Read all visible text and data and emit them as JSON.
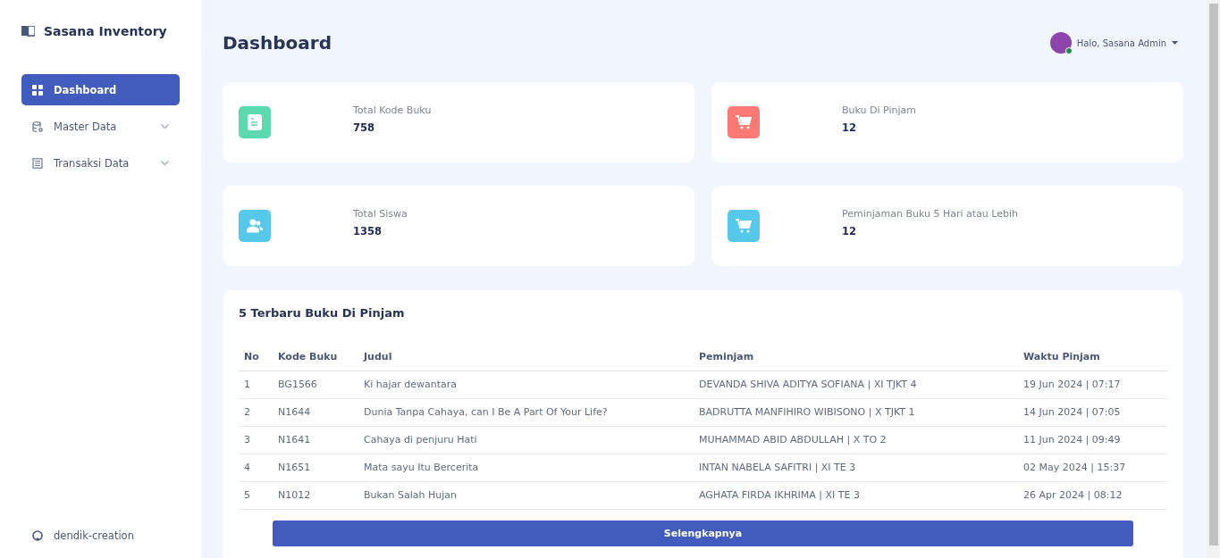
{
  "sidebar": {
    "brand": "Sasana Inventory",
    "items": [
      {
        "label": "Dashboard",
        "selected": true,
        "expandable": false
      },
      {
        "label": "Master Data",
        "selected": false,
        "expandable": true
      },
      {
        "label": "Transaksi Data",
        "selected": false,
        "expandable": true
      }
    ],
    "footer_link": "dendik-creation"
  },
  "header": {
    "title": "Dashboard",
    "user": "Halo, Sasana Admin",
    "online": true
  },
  "stats": [
    {
      "label": "Total Kode Buku",
      "value": "758",
      "color": "#5dd9b0"
    },
    {
      "label": "Buku Di Pinjam",
      "value": "12",
      "color": "#fc7a73"
    },
    {
      "label": "Total Siswa",
      "value": "1358",
      "color": "#56c9ea"
    },
    {
      "label": "Peminjaman Buku 5 Hari atau Lebih",
      "value": "12",
      "color": "#56c9ea"
    }
  ],
  "table": {
    "title": "5 Terbaru Buku Di Pinjam",
    "columns": [
      "No",
      "Kode Buku",
      "Judul",
      "Peminjam",
      "Waktu Pinjam"
    ],
    "rows": [
      [
        "1",
        "BG1566",
        "Ki hajar dewantara",
        "DEVANDA SHIVA ADITYA SOFIANA | XI TJKT 4",
        "19 Jun 2024 | 07:17"
      ],
      [
        "2",
        "N1644",
        "Dunia Tanpa Cahaya, can I Be A Part Of Your Life?",
        "BADRUTTA MANFIHIRO WIBISONO | X TJKT 1",
        "14 Jun 2024 | 07:05"
      ],
      [
        "3",
        "N1641",
        "Cahaya di penjuru Hati",
        "MUHAMMAD ABID ABDULLAH | X TO 2",
        "11 Jun 2024 | 09:49"
      ],
      [
        "4",
        "N1651",
        "Mata sayu Itu Bercerita",
        "INTAN NABELA SAFITRI | XI TE 3",
        "02 May 2024 | 15:37"
      ],
      [
        "5",
        "N1012",
        "Bukan Salah Hujan",
        "AGHATA FIRDA IKHRIMA | XI TE 3",
        "26 Apr 2024 | 08:12"
      ]
    ],
    "button": "Selengkapnya"
  }
}
